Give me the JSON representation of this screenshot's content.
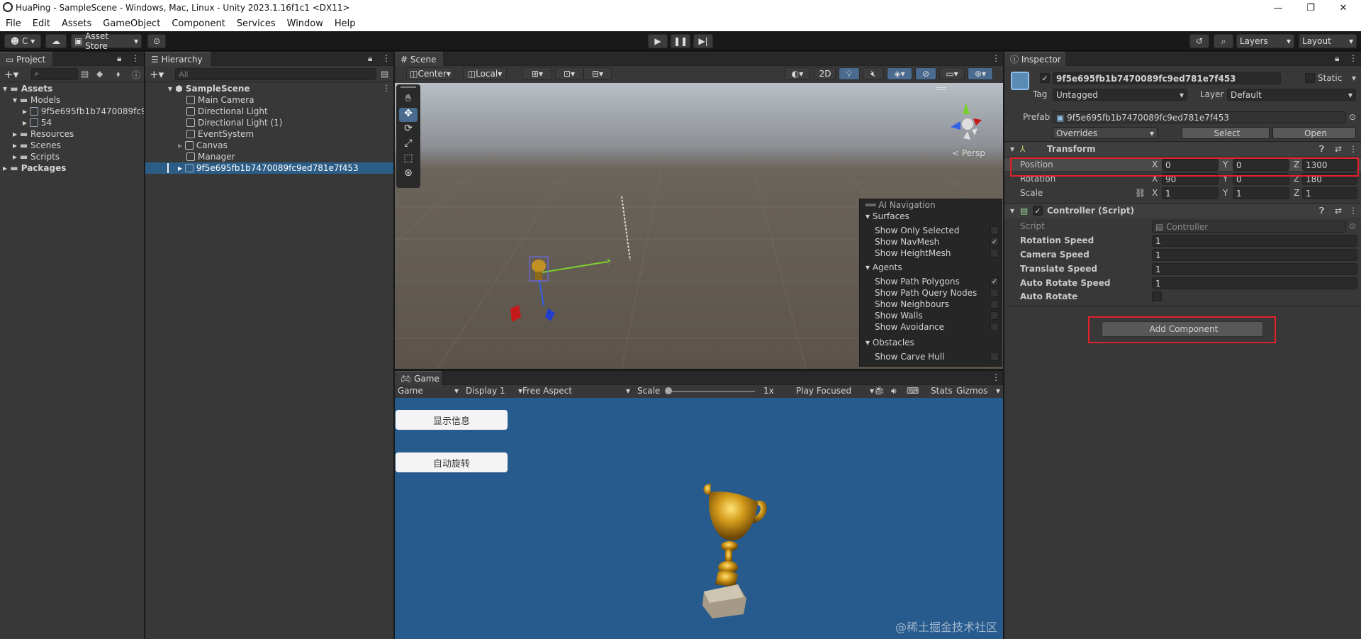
{
  "window": {
    "title": "HuaPing - SampleScene - Windows, Mac, Linux - Unity 2023.1.16f1c1 <DX11>"
  },
  "menu": [
    "File",
    "Edit",
    "Assets",
    "GameObject",
    "Component",
    "Services",
    "Window",
    "Help"
  ],
  "toolbar": {
    "account": "C",
    "asset_store": "Asset Store",
    "layers": "Layers",
    "layout": "Layout"
  },
  "project": {
    "tab": "Project",
    "tree": [
      {
        "label": "Assets",
        "bold": true
      },
      {
        "label": "Models"
      },
      {
        "label": "9f5e695fb1b7470089fc9"
      },
      {
        "label": "54"
      },
      {
        "label": "Resources"
      },
      {
        "label": "Scenes"
      },
      {
        "label": "Scripts"
      },
      {
        "label": "Packages",
        "bold": true
      }
    ]
  },
  "hierarchy": {
    "tab": "Hierarchy",
    "search_placeholder": "All",
    "scene": "SampleScene",
    "items": [
      "Main Camera",
      "Directional Light",
      "Directional Light (1)",
      "EventSystem",
      "Canvas",
      "Manager",
      "9f5e695fb1b7470089fc9ed781e7f453"
    ]
  },
  "scene_view": {
    "tab": "Scene",
    "pivot": "Center",
    "space": "Local",
    "mode_2d": "2D",
    "persp": "< Persp"
  },
  "ai_navigation": {
    "title": "AI Navigation",
    "surfaces_header": "Surfaces",
    "surfaces": [
      {
        "label": "Show Only Selected",
        "checked": false
      },
      {
        "label": "Show NavMesh",
        "checked": true
      },
      {
        "label": "Show HeightMesh",
        "checked": false
      }
    ],
    "agents_header": "Agents",
    "agents": [
      {
        "label": "Show Path Polygons",
        "checked": true
      },
      {
        "label": "Show Path Query Nodes",
        "checked": false
      },
      {
        "label": "Show Neighbours",
        "checked": false
      },
      {
        "label": "Show Walls",
        "checked": false
      },
      {
        "label": "Show Avoidance",
        "checked": false
      }
    ],
    "obstacles_header": "Obstacles",
    "obstacles": [
      {
        "label": "Show Carve Hull",
        "checked": false
      }
    ]
  },
  "game_view": {
    "tab": "Game",
    "mode": "Game",
    "display": "Display 1",
    "aspect": "Free Aspect",
    "scale_label": "Scale",
    "scale_value": "1x",
    "play_mode": "Play Focused",
    "stats": "Stats",
    "gizmos": "Gizmos",
    "buttons": [
      "显示信息",
      "自动旋转"
    ]
  },
  "inspector": {
    "tab": "Inspector",
    "object_name": "9f5e695fb1b7470089fc9ed781e7f453",
    "static_label": "Static",
    "tag_label": "Tag",
    "tag_value": "Untagged",
    "layer_label": "Layer",
    "layer_value": "Default",
    "prefab_label": "Prefab",
    "prefab_value": "9f5e695fb1b7470089fc9ed781e7f453",
    "overrides": "Overrides",
    "select": "Select",
    "open": "Open",
    "transform": {
      "title": "Transform",
      "rows": [
        {
          "label": "Position",
          "x": "0",
          "y": "0",
          "z": "1300"
        },
        {
          "label": "Rotation",
          "x": "90",
          "y": "0",
          "z": "180"
        },
        {
          "label": "Scale",
          "x": "1",
          "y": "1",
          "z": "1"
        }
      ]
    },
    "controller": {
      "title": "Controller (Script)",
      "script_label": "Script",
      "script_value": "Controller",
      "fields": [
        {
          "label": "Rotation Speed",
          "value": "1"
        },
        {
          "label": "Camera Speed",
          "value": "1"
        },
        {
          "label": "Translate Speed",
          "value": "1"
        },
        {
          "label": "Auto Rotate Speed",
          "value": "1"
        }
      ],
      "auto_rotate_label": "Auto Rotate"
    },
    "add_component": "Add Component"
  },
  "watermark": "@稀土掘金技术社区",
  "colors": {
    "selection": "#2c5d87",
    "highlight": "#e0202a",
    "game_background": "#275a8d"
  }
}
